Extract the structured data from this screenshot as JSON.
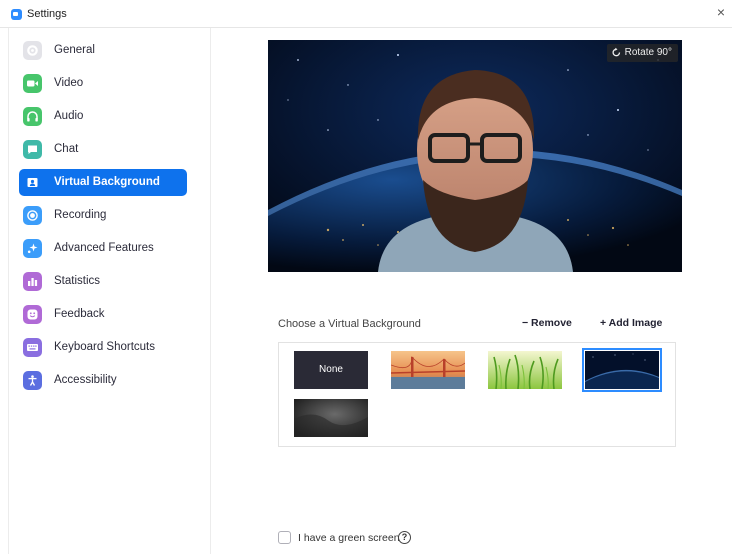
{
  "window": {
    "title": "Settings",
    "close_glyph": "×"
  },
  "colors": {
    "accent": "#0e72ed",
    "selected_outline": "#2d8cff"
  },
  "sidebar": {
    "items": [
      {
        "label": "General",
        "icon": "gear-icon",
        "color": "#e0e0e6"
      },
      {
        "label": "Video",
        "icon": "camera-icon",
        "color": "#47c56b"
      },
      {
        "label": "Audio",
        "icon": "headphones-icon",
        "color": "#47c56b"
      },
      {
        "label": "Chat",
        "icon": "chat-icon",
        "color": "#3fb9a8"
      },
      {
        "label": "Virtual Background",
        "icon": "person-icon",
        "color": "#0e72ed",
        "active": true
      },
      {
        "label": "Recording",
        "icon": "record-icon",
        "color": "#3b9dfa"
      },
      {
        "label": "Advanced Features",
        "icon": "sparkle-icon",
        "color": "#3b9dfa"
      },
      {
        "label": "Statistics",
        "icon": "bar-chart-icon",
        "color": "#b06ad6"
      },
      {
        "label": "Feedback",
        "icon": "smile-icon",
        "color": "#b06ad6"
      },
      {
        "label": "Keyboard Shortcuts",
        "icon": "keyboard-icon",
        "color": "#8a6ee0"
      },
      {
        "label": "Accessibility",
        "icon": "accessibility-icon",
        "color": "#5b6ee0"
      }
    ]
  },
  "preview": {
    "rotate_label": "Rotate 90°"
  },
  "background_panel": {
    "choose_label": "Choose a Virtual Background",
    "remove_label": "− Remove",
    "add_label": "+ Add Image",
    "thumbs": [
      {
        "name": "none",
        "label": "None"
      },
      {
        "name": "golden-gate"
      },
      {
        "name": "grass"
      },
      {
        "name": "earth-space",
        "selected": true
      },
      {
        "name": "dark-texture"
      }
    ]
  },
  "green_screen": {
    "label": "I have a green screen",
    "checked": false,
    "help_glyph": "?"
  }
}
